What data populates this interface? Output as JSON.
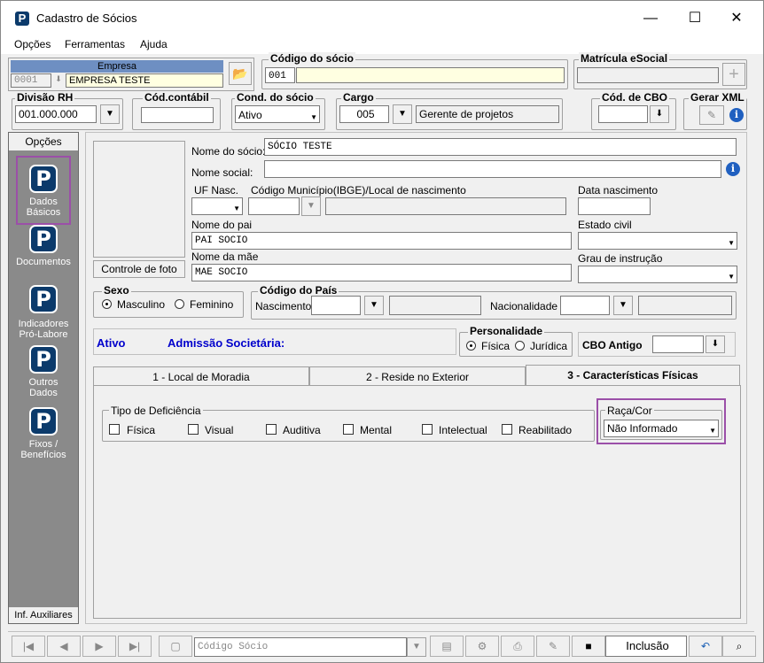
{
  "window": {
    "title": "Cadastro de Sócios",
    "minimize": "—",
    "maximize": "☐",
    "close": "✕"
  },
  "menu": [
    "Opções",
    "Ferramentas",
    "Ajuda"
  ],
  "empresa": {
    "label": "Empresa",
    "code": "0001",
    "name": "EMPRESA TESTE"
  },
  "codigo_socio": {
    "label": "Código do sócio",
    "value": "001"
  },
  "matricula": {
    "label": "Matrícula eSocial",
    "value": ""
  },
  "divisao": {
    "label": "Divisão RH",
    "value": "001.000.000"
  },
  "cod_contabil": {
    "label": "Cód.contábil",
    "value": ""
  },
  "cond_socio": {
    "label": "Cond. do sócio",
    "value": "Ativo"
  },
  "cargo": {
    "label": "Cargo",
    "code": "005",
    "name": "Gerente de projetos"
  },
  "cbo": {
    "label": "Cód. de CBO",
    "value": ""
  },
  "gerar_xml": {
    "label": "Gerar XML"
  },
  "sidebar": {
    "header": "Opções",
    "footer": "Inf. Auxiliares",
    "items": [
      "Dados Básicos",
      "Documentos",
      "Indicadores Pró-Labore",
      "Outros Dados",
      "Fixos / Benefícios"
    ]
  },
  "form": {
    "foto_button": "Controle de foto",
    "nome_socio_label": "Nome do sócio:",
    "nome_socio": "SÓCIO TESTE",
    "nome_social_label": "Nome social:",
    "nome_social": "",
    "uf_nasc_label": "UF Nasc.",
    "municipio_label": "Código Município(IBGE)/Local de nascimento",
    "data_nasc_label": "Data nascimento",
    "nome_pai_label": "Nome do pai",
    "nome_pai": "PAI SOCIO",
    "estado_civil_label": "Estado civil",
    "nome_mae_label": "Nome da mãe",
    "nome_mae": "MAE SOCIO",
    "grau_instrucao_label": "Grau de instrução"
  },
  "sexo": {
    "label": "Sexo",
    "masculino": "Masculino",
    "feminino": "Feminino",
    "selected": "Masculino"
  },
  "pais": {
    "label": "Código do País",
    "nascimento": "Nascimento",
    "nacionalidade": "Nacionalidade"
  },
  "status": {
    "ativo": "Ativo",
    "admissao": "Admissão Societária:"
  },
  "personalidade": {
    "label": "Personalidade",
    "fisica": "Física",
    "juridica": "Jurídica",
    "selected": "Física"
  },
  "cbo_antigo": {
    "label": "CBO Antigo",
    "value": ""
  },
  "tabs": [
    "1 - Local de Moradia",
    "2 - Reside no Exterior",
    "3 - Características Físicas"
  ],
  "deficiencia": {
    "label": "Tipo de Deficiência",
    "options": [
      "Física",
      "Visual",
      "Auditiva",
      "Mental",
      "Intelectual",
      "Reabilitado"
    ]
  },
  "raca": {
    "label": "Raça/Cor",
    "value": "Não Informado"
  },
  "navbar": {
    "search_placeholder": "Código Sócio",
    "mode": "Inclusão"
  },
  "colors": {
    "accent_blue": "#0000cc",
    "highlight_purple": "#9b4fa8",
    "sidebar_gray": "#8a8a8a",
    "field_yellow": "#ffffe1"
  }
}
